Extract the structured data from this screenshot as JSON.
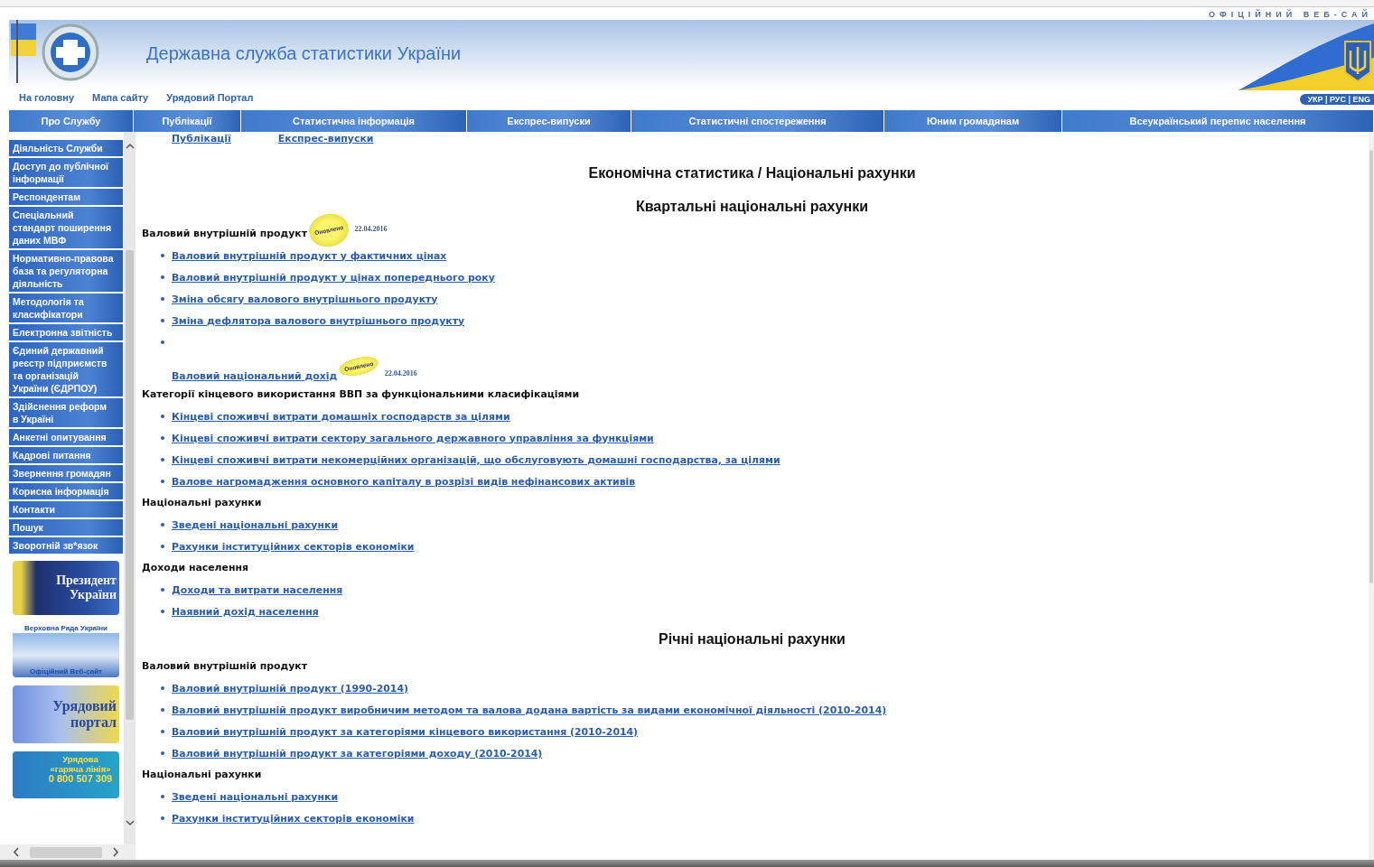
{
  "header": {
    "tagline": "ОФІЦІЙНИЙ ВЕБ-САЙ",
    "title": "Державна служба статистики України",
    "links": [
      "На головну",
      "Мапа сайту",
      "Урядовий Портал"
    ],
    "languages": "УКР | РУС | ENG"
  },
  "nav": [
    "Про Службу",
    "Публікації",
    "Статистична інформація",
    "Експрес-випуски",
    "Статистичні спостереження",
    "Юним громадянам",
    "Всеукраїнський перепис населення"
  ],
  "sidebar": {
    "items": [
      "Діяльність Служби",
      "Доступ до публічної інформації",
      "Респондентам",
      "Спеціальний стандарт поширення даних МВФ",
      "Нормативно-правова база та регуляторна діяльність",
      "Методологія та класифікатори",
      "Електронна звітність",
      "Єдиний державний реєстр підприємств та організацій України (ЄДРПОУ)",
      "Здійснення реформ в Україні",
      "Анкетні опитування",
      "Кадрові питання",
      "Звернення громадян",
      "Корисна інформація",
      "Контакти",
      "Пошук",
      "Зворотній зв*язок"
    ],
    "banners": [
      {
        "kind": "president",
        "lines": [
          "Президент",
          "України"
        ]
      },
      {
        "kind": "rada",
        "lines": [
          "Верховна Рада України",
          "Офіційний Веб-сайт"
        ]
      },
      {
        "kind": "portal",
        "lines": [
          "Урядовий",
          "портал"
        ]
      },
      {
        "kind": "hotline",
        "lines": [
          "Урядова",
          "«гаряча лінія»",
          "0 800 507 309"
        ]
      }
    ]
  },
  "content": {
    "top_links": [
      "Публікації",
      "Експрес-випуски"
    ],
    "title": "Економічна статистика / Національні рахунки",
    "blocks": [
      {
        "kind": "subtitle",
        "text": "Квартальні національні рахунки"
      },
      {
        "kind": "section",
        "heading": "Валовий внутрішній продукт",
        "badge": {
          "label": "Оновлено",
          "date": "22.04.2016"
        },
        "items": [
          {
            "kind": "link",
            "text": "Валовий внутрішній продукт у фактичних цінах"
          },
          {
            "kind": "link",
            "text": "Валовий внутрішній продукт у цінах попереднього року"
          },
          {
            "kind": "link",
            "text": "Зміна обсягу валового внутрішнього продукту"
          },
          {
            "kind": "link",
            "text": "Зміна дефлятора валового внутрішнього продукту"
          },
          {
            "kind": "empty"
          },
          {
            "kind": "unbulleted",
            "text": "Валовий національний дохід",
            "badge": {
              "label": "Оновлено",
              "date": "22.04.2016"
            }
          }
        ]
      },
      {
        "kind": "section",
        "heading": "Категорії кінцевого використання ВВП за функціональними класифікаціями",
        "items": [
          {
            "kind": "link",
            "text": "Кінцеві споживчі витрати домашніх господарств за цілями"
          },
          {
            "kind": "link",
            "text": "Кінцеві споживчі витрати сектору загального державного управління за функціями"
          },
          {
            "kind": "link",
            "text": "Кінцеві споживчі витрати некомерційних організацій, що обслуговують домашні господарства, за цілями"
          },
          {
            "kind": "link",
            "text": "Валове нагромадження основного капіталу в розрізі видів нефінансових активів"
          }
        ]
      },
      {
        "kind": "section",
        "heading": "Національні рахунки",
        "items": [
          {
            "kind": "link",
            "text": "Зведені національні рахунки"
          },
          {
            "kind": "link",
            "text": "Рахунки інституційних секторів економіки"
          }
        ]
      },
      {
        "kind": "section",
        "heading": "Доходи населення",
        "items": [
          {
            "kind": "link",
            "text": "Доходи та витрати населення"
          },
          {
            "kind": "link",
            "text": "Наявний дохід населення"
          }
        ]
      },
      {
        "kind": "subtitle",
        "text": "Річні національні рахунки"
      },
      {
        "kind": "section",
        "heading": "Валовий внутрішній продукт",
        "items": [
          {
            "kind": "link",
            "text": "Валовий внутрішній продукт (1990-2014)"
          },
          {
            "kind": "link",
            "text": "Валовий внутрішній продукт виробничим методом та валова додана вартість за видами економічної діяльності (2010-2014)"
          },
          {
            "kind": "link",
            "text": "Валовий внутрішній продукт за категоріями кінцевого використання (2010-2014)"
          },
          {
            "kind": "link",
            "text": "Валовий внутрішній продукт за категоріями доходу (2010-2014)"
          }
        ]
      },
      {
        "kind": "section",
        "heading": "Національні рахунки",
        "items": [
          {
            "kind": "link",
            "text": "Зведені національні рахунки"
          },
          {
            "kind": "link",
            "text": "Рахунки інституційних секторів економіки"
          }
        ]
      }
    ]
  }
}
